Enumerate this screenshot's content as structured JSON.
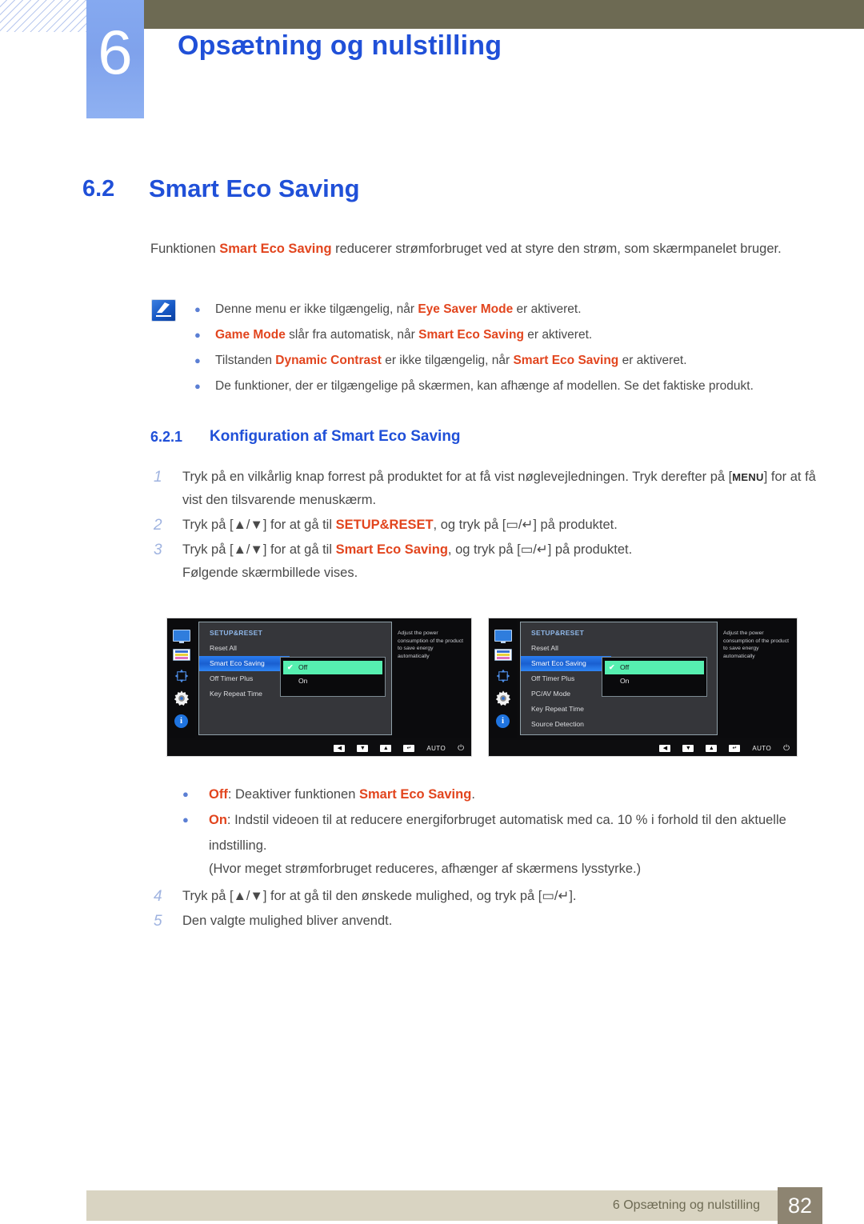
{
  "header": {
    "chapter_number": "6",
    "chapter_title": "Opsætning og nulstilling"
  },
  "section": {
    "number": "6.2",
    "title": "Smart Eco Saving",
    "intro_pre": "Funktionen ",
    "intro_hl": "Smart Eco Saving",
    "intro_post": " reducerer strømforbruget ved at styre den strøm, som skærmpanelet bruger."
  },
  "notes": {
    "icon": "note-pen-icon",
    "items": [
      {
        "pre": "Denne menu er ikke tilgængelig, når ",
        "hl": "Eye Saver Mode",
        "post": " er aktiveret."
      },
      {
        "pre": "",
        "hl": "Game Mode",
        "mid": " slår fra automatisk, når ",
        "hl2": "Smart Eco Saving",
        "post": " er aktiveret."
      },
      {
        "pre": "Tilstanden ",
        "hl": "Dynamic Contrast",
        "mid": " er ikke tilgængelig, når ",
        "hl2": "Smart Eco Saving",
        "post": " er aktiveret."
      },
      {
        "pre": "De funktioner, der er tilgængelige på skærmen, kan afhænge af modellen. Se det faktiske produkt.",
        "hl": "",
        "post": ""
      }
    ]
  },
  "subsection": {
    "number": "6.2.1",
    "title": "Konfiguration af Smart Eco Saving"
  },
  "steps": [
    {
      "num": "1",
      "pre": "Tryk på en vilkårlig knap forrest på produktet for at få vist nøglevejledningen. Tryk derefter på [",
      "key": "MENU",
      "post": "] for at få vist den tilsvarende menuskærm."
    },
    {
      "num": "2",
      "pre": "Tryk på [▲/▼] for at gå til ",
      "hl": "SETUP&RESET",
      "post": ", og tryk på [▭/↵] på produktet."
    },
    {
      "num": "3",
      "pre": "Tryk på [▲/▼] for at gå til ",
      "hl": "Smart Eco Saving",
      "post": ", og tryk på [▭/↵] på produktet.",
      "sub": "Følgende skærmbillede vises."
    }
  ],
  "steps_after": [
    {
      "num": "4",
      "pre": "Tryk på [▲/▼] for at gå til den ønskede mulighed, og tryk på [▭/↵]."
    },
    {
      "num": "5",
      "pre": "Den valgte mulighed bliver anvendt."
    }
  ],
  "osd": {
    "rail_icons": [
      "monitor-icon",
      "color-bars-icon",
      "position-arrows-icon",
      "gear-icon",
      "info-icon"
    ],
    "title": "SETUP&RESET",
    "description": "Adjust the power consumption of the product to save energy automatically",
    "submenu": {
      "options": [
        "Off",
        "On"
      ],
      "selected": "Off",
      "check_glyph": "✔"
    },
    "bottom_buttons": [
      "◀",
      "▼",
      "▲",
      "↵"
    ],
    "auto_label": "AUTO",
    "power_glyph": "⏻",
    "colors": {
      "selected_row": "#2a7df0",
      "selected_option": "#56efb0",
      "title_blue": "#8fb7e8"
    },
    "left": {
      "items": [
        "Reset All",
        "Smart Eco Saving",
        "Off Timer Plus",
        "Key Repeat Time"
      ],
      "highlighted": "Smart Eco Saving"
    },
    "right": {
      "items": [
        "Reset All",
        "Smart Eco Saving",
        "Off Timer Plus",
        "PC/AV Mode",
        "Key Repeat Time",
        "Source Detection"
      ],
      "highlighted": "Smart Eco Saving"
    }
  },
  "options": [
    {
      "hl": "Off",
      "mid": ": Deaktiver funktionen ",
      "hl2": "Smart Eco Saving",
      "post": "."
    },
    {
      "hl": "On",
      "mid": ": Indstil videoen til at reducere energiforbruget automatisk med ca. 10 % i forhold til den aktuelle indstilling.",
      "hl2": "",
      "post": ""
    }
  ],
  "options_paren": "(Hvor meget strømforbruget reduceres, afhænger af skærmens lysstyrke.)",
  "footer": {
    "text": "6 Opsætning og nulstilling",
    "page": "82"
  }
}
